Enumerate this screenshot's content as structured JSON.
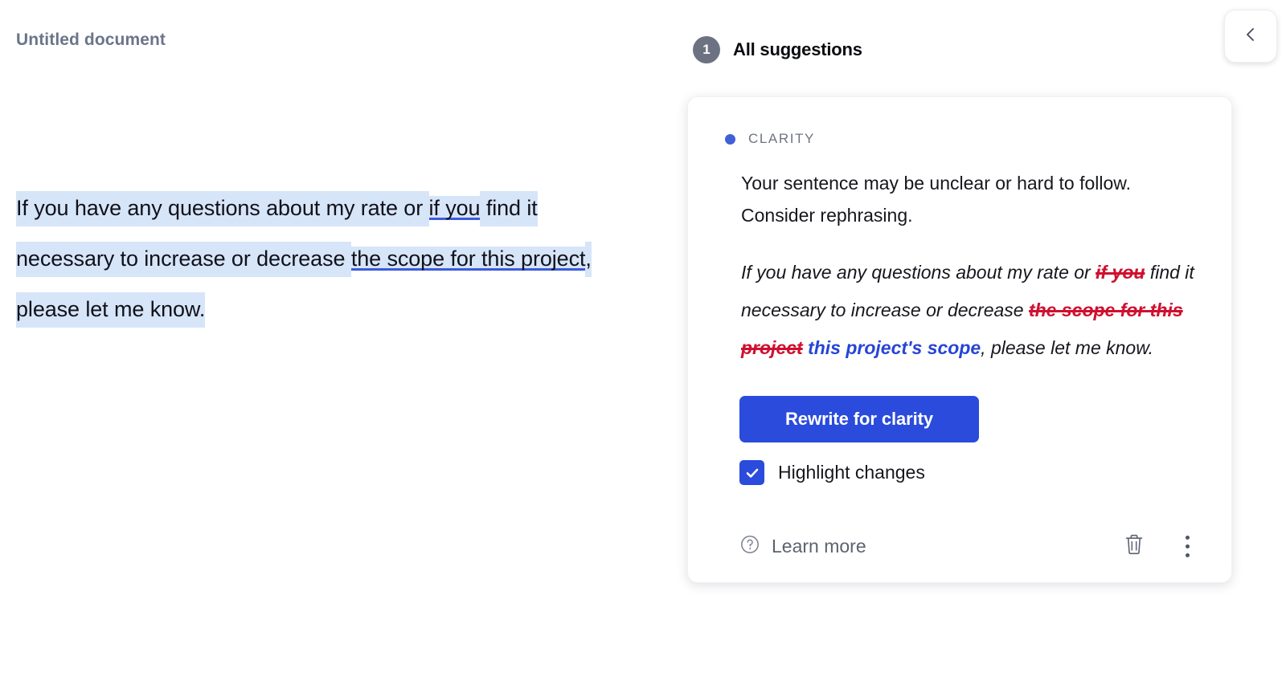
{
  "document": {
    "title": "Untitled document",
    "sentence_parts": [
      {
        "text": "If you have any questions about my rate or ",
        "style": "highlight"
      },
      {
        "text": "if you",
        "style": "highlight-underline"
      },
      {
        "text": " find it necessary to increase or decrease ",
        "style": "highlight"
      },
      {
        "text": "the scope for this project",
        "style": "highlight-underline"
      },
      {
        "text": ", please let me know.",
        "style": "highlight"
      }
    ],
    "full_text": "If you have any questions about my rate or if you find it necessary to increase or decrease the scope for this project, please let me know."
  },
  "sidebar": {
    "suggestion_count": "1",
    "panel_title": "All suggestions",
    "collapse_icon": "chevron-left-icon"
  },
  "card": {
    "category": "CLARITY",
    "category_dot_color": "#4060d8",
    "explanation": "Your sentence may be unclear or hard to follow. Consider rephrasing.",
    "preview": {
      "segments": [
        {
          "text": "If you have any questions about my rate or ",
          "type": "normal"
        },
        {
          "text": "if you",
          "type": "deleted"
        },
        {
          "text": " find it necessary to increase or decrease ",
          "type": "normal"
        },
        {
          "text": "the scope for this project",
          "type": "deleted"
        },
        {
          "text": " ",
          "type": "normal"
        },
        {
          "text": "this project's scope",
          "type": "inserted"
        },
        {
          "text": ", please let me know.",
          "type": "normal"
        }
      ],
      "deleted_color": "#cf1030",
      "inserted_color": "#2744d6"
    },
    "rewrite_button_label": "Rewrite for clarity",
    "highlight_changes_label": "Highlight changes",
    "highlight_changes_checked": true,
    "learn_more_label": "Learn more",
    "learn_more_icon": "question-circle-icon",
    "delete_icon": "trash-icon",
    "more_icon": "kebab-menu-icon"
  },
  "colors": {
    "accent_blue": "#2a4bdb",
    "highlight_blue": "#d7e5f8",
    "underline_blue": "#3b5bdb",
    "badge_gray": "#6d7282",
    "title_gray": "#6b7489"
  }
}
